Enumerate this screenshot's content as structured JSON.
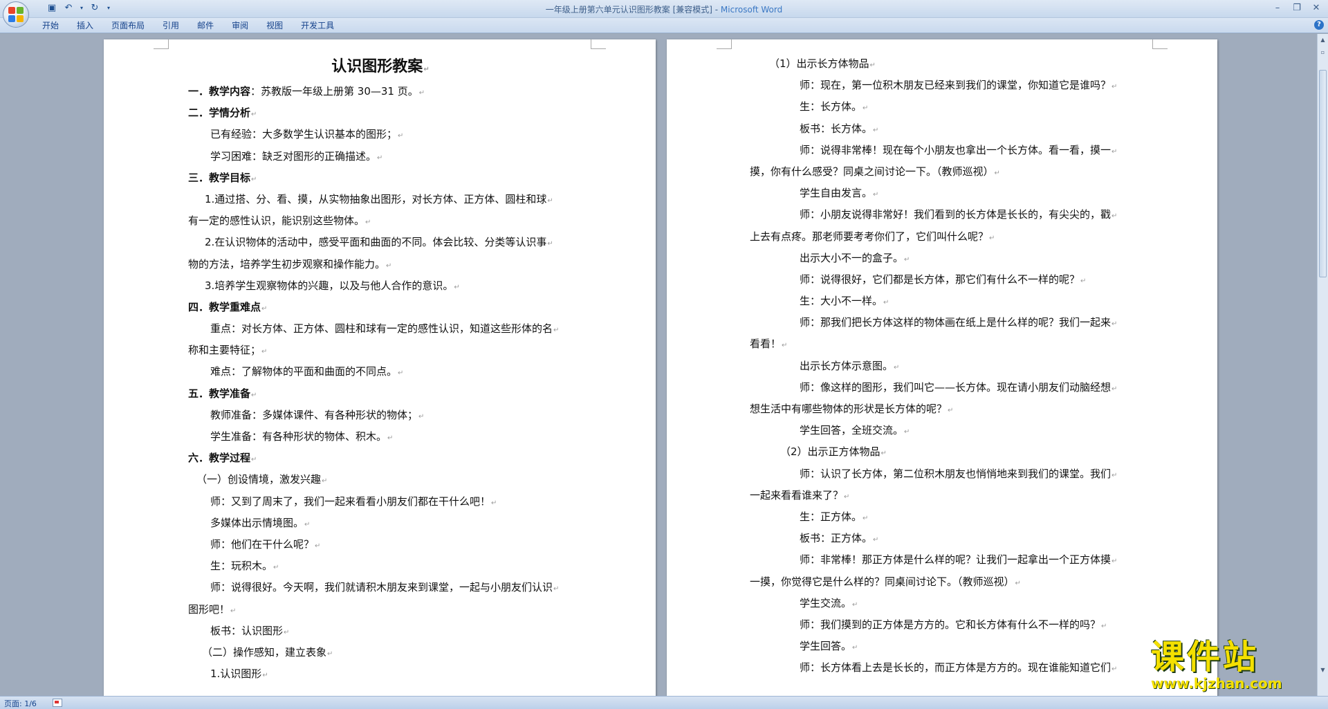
{
  "window": {
    "title": "一年级上册第六单元认识图形教案 [兼容模式] - ",
    "app_name": "Microsoft Word"
  },
  "ribbon": {
    "tabs": [
      "开始",
      "插入",
      "页面布局",
      "引用",
      "邮件",
      "审阅",
      "视图",
      "开发工具"
    ]
  },
  "document": {
    "title": "认识图形教案",
    "page1": [
      {
        "bold": "一．教学内容",
        "text": "：苏教版一年级上册第 30—31 页。",
        "indent": 0
      },
      {
        "bold": "二．学情分析",
        "text": "",
        "indent": 0
      },
      {
        "text": "已有经验：大多数学生认识基本的图形；",
        "indent": 32
      },
      {
        "text": "学习困难：缺乏对图形的正确描述。",
        "indent": 32
      },
      {
        "bold": "三．教学目标",
        "text": "",
        "indent": 0
      },
      {
        "text": "1.通过搭、分、看、摸，从实物抽象出图形，对长方体、正方体、圆柱和球",
        "indent": 24
      },
      {
        "text": "有一定的感性认识，能识别这些物体。",
        "indent": 0
      },
      {
        "text": "2.在认识物体的活动中，感受平面和曲面的不同。体会比较、分类等认识事",
        "indent": 24
      },
      {
        "text": "物的方法，培养学生初步观察和操作能力。",
        "indent": 0
      },
      {
        "text": "3.培养学生观察物体的兴趣，以及与他人合作的意识。",
        "indent": 24
      },
      {
        "bold": "四．教学重难点",
        "text": "",
        "indent": 0
      },
      {
        "text": "重点：对长方体、正方体、圆柱和球有一定的感性认识，知道这些形体的名",
        "indent": 32
      },
      {
        "text": "称和主要特征；",
        "indent": 0
      },
      {
        "text": "难点：了解物体的平面和曲面的不同点。",
        "indent": 32
      },
      {
        "bold": "五．教学准备",
        "text": "",
        "indent": 0
      },
      {
        "text": "教师准备：多媒体课件、有各种形状的物体；",
        "indent": 32
      },
      {
        "text": "学生准备：有各种形状的物体、积木。",
        "indent": 32
      },
      {
        "bold": "六．教学过程",
        "text": "",
        "indent": 0
      },
      {
        "text": "（一）创设情境，激发兴趣",
        "indent": 12
      },
      {
        "text": "师：又到了周末了，我们一起来看看小朋友们都在干什么吧！",
        "indent": 32
      },
      {
        "text": "多媒体出示情境图。",
        "indent": 32
      },
      {
        "text": "师：他们在干什么呢？",
        "indent": 32
      },
      {
        "text": "生：玩积木。",
        "indent": 32
      },
      {
        "text": "师：说得很好。今天啊，我们就请积木朋友来到课堂，一起与小朋友们认识",
        "indent": 32
      },
      {
        "text": "图形吧！",
        "indent": 0
      },
      {
        "text": "板书：认识图形",
        "indent": 32
      },
      {
        "text": "（二）操作感知，建立表象",
        "indent": 20
      },
      {
        "text": "1.认识图形",
        "indent": 32
      }
    ],
    "page2": [
      {
        "text": "（1）出示长方体物品",
        "indent": 28
      },
      {
        "text": "师：现在，第一位积木朋友已经来到我们的课堂，你知道它是谁吗？",
        "indent": 72
      },
      {
        "text": "生：长方体。",
        "indent": 72
      },
      {
        "text": "板书：长方体。",
        "indent": 72
      },
      {
        "text": "师：说得非常棒！现在每个小朋友也拿出一个长方体。看一看，摸一",
        "indent": 72
      },
      {
        "text": "摸，你有什么感受？同桌之间讨论一下。（教师巡视）",
        "indent": 0
      },
      {
        "text": "学生自由发言。",
        "indent": 72
      },
      {
        "text": "师：小朋友说得非常好！我们看到的长方体是长长的，有尖尖的，戳",
        "indent": 72
      },
      {
        "text": "上去有点疼。那老师要考考你们了，它们叫什么呢？",
        "indent": 0
      },
      {
        "text": "出示大小不一的盒子。",
        "indent": 72
      },
      {
        "text": "师：说得很好，它们都是长方体，那它们有什么不一样的呢？",
        "indent": 72
      },
      {
        "text": "生：大小不一样。",
        "indent": 72
      },
      {
        "text": "师：那我们把长方体这样的物体画在纸上是什么样的呢？我们一起来",
        "indent": 72
      },
      {
        "text": "看看！",
        "indent": 0
      },
      {
        "text": "出示长方体示意图。",
        "indent": 72
      },
      {
        "text": "师：像这样的图形，我们叫它——长方体。现在请小朋友们动脑经想",
        "indent": 72
      },
      {
        "text": "想生活中有哪些物体的形状是长方体的呢？",
        "indent": 0
      },
      {
        "text": "学生回答，全班交流。",
        "indent": 72
      },
      {
        "text": "（2）出示正方体物品",
        "indent": 44
      },
      {
        "text": "师：认识了长方体，第二位积木朋友也悄悄地来到我们的课堂。我们",
        "indent": 72
      },
      {
        "text": "一起来看看谁来了？",
        "indent": 0
      },
      {
        "text": "生：正方体。",
        "indent": 72
      },
      {
        "text": "板书：正方体。",
        "indent": 72
      },
      {
        "text": "师：非常棒！那正方体是什么样的呢？让我们一起拿出一个正方体摸",
        "indent": 72
      },
      {
        "text": "一摸，你觉得它是什么样的？同桌间讨论下。（教师巡视）",
        "indent": 0
      },
      {
        "text": "学生交流。",
        "indent": 72
      },
      {
        "text": "师：我们摸到的正方体是方方的。它和长方体有什么不一样的吗？",
        "indent": 72
      },
      {
        "text": "学生回答。",
        "indent": 72
      },
      {
        "text": "师：长方体看上去是长长的，而正方体是方方的。现在谁能知道它们",
        "indent": 72
      }
    ]
  },
  "status": {
    "page_info": "页面: 1/6"
  },
  "watermark": {
    "main": "课件站",
    "url": "www.kjzhan.com"
  },
  "icons": {
    "para_mark": "↵"
  }
}
